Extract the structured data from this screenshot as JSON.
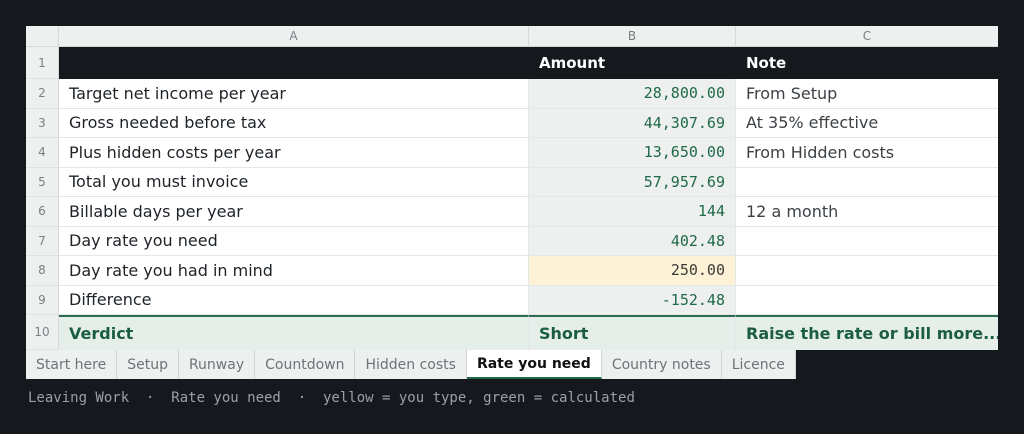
{
  "sheet": {
    "columns": [
      "A",
      "B",
      "C"
    ],
    "header_row": {
      "num": "1",
      "a": "",
      "b": "Amount",
      "c": "Note"
    },
    "rows": [
      {
        "num": "2",
        "label": "Target net income per year",
        "amount": "28,800.00",
        "note": "From Setup",
        "kind": "calc"
      },
      {
        "num": "3",
        "label": "Gross needed before tax",
        "amount": "44,307.69",
        "note": "At 35% effective",
        "kind": "calc"
      },
      {
        "num": "4",
        "label": "Plus hidden costs per year",
        "amount": "13,650.00",
        "note": "From Hidden costs",
        "kind": "calc"
      },
      {
        "num": "5",
        "label": "Total you must invoice",
        "amount": "57,957.69",
        "note": "",
        "kind": "calc"
      },
      {
        "num": "6",
        "label": "Billable days per year",
        "amount": "144",
        "note": "12 a month",
        "kind": "calc"
      },
      {
        "num": "7",
        "label": "Day rate you need",
        "amount": "402.48",
        "note": "",
        "kind": "calc"
      },
      {
        "num": "8",
        "label": "Day rate you had in mind",
        "amount": "250.00",
        "note": "",
        "kind": "input"
      },
      {
        "num": "9",
        "label": "Difference",
        "amount": "-152.48",
        "note": "",
        "kind": "calc"
      }
    ],
    "verdict_row": {
      "num": "10",
      "label": "Verdict",
      "amount": "Short",
      "note": "Raise the rate or bill more..."
    }
  },
  "tabs": [
    "Start here",
    "Setup",
    "Runway",
    "Countdown",
    "Hidden costs",
    "Rate you need",
    "Country notes",
    "Licence"
  ],
  "active_tab": "Rate you need",
  "status_bar": "Leaving Work  ·  Rate you need  ·  yellow = you type, green = calculated",
  "colors": {
    "background": "#15191e",
    "calculated": "#1f6a48",
    "input_fill": "#fdf1d6",
    "verdict_fill": "#e6eeea"
  }
}
